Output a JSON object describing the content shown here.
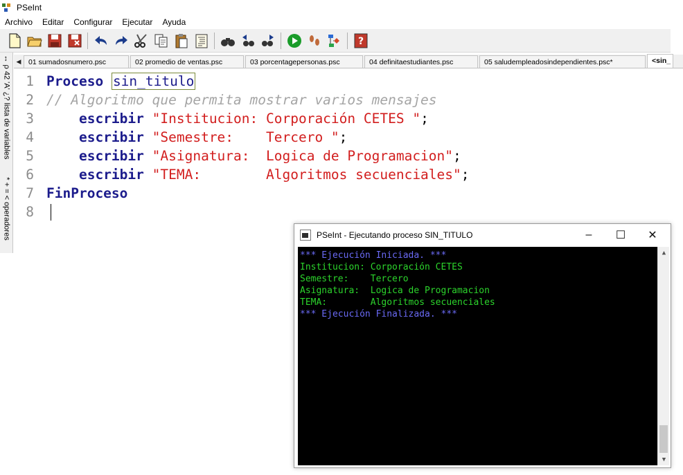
{
  "window": {
    "title": "PSeInt"
  },
  "menu": [
    "Archivo",
    "Editar",
    "Configurar",
    "Ejecutar",
    "Ayuda"
  ],
  "toolbar": {
    "icons": [
      "new-file-icon",
      "open-folder-icon",
      "save-icon",
      "save-as-icon",
      "undo-icon",
      "redo-icon",
      "cut-icon",
      "copy-icon",
      "paste-icon",
      "correct-indent-icon",
      "find-icon",
      "find-previous-icon",
      "find-next-icon",
      "run-icon",
      "step-by-step-icon",
      "flowchart-icon",
      "help-icon"
    ]
  },
  "side_panel": {
    "variables_label": "↔ ρ 42 'A' ¿? lista de variables",
    "operators_label": "* + = < operadores"
  },
  "tabs": [
    {
      "label": "01 sumadosnumero.psc",
      "active": false
    },
    {
      "label": "02 promedio de ventas.psc",
      "active": false
    },
    {
      "label": "03 porcentagepersonas.psc",
      "active": false
    },
    {
      "label": "04 definitaestudiantes.psc",
      "active": false
    },
    {
      "label": "05 saludempleadosindependientes.psc*",
      "active": false
    },
    {
      "label": "<sin_",
      "active": true
    }
  ],
  "editor": {
    "line_numbers": [
      "1",
      "2",
      "3",
      "4",
      "5",
      "6",
      "7",
      "8"
    ],
    "proceso_kw": "Proceso",
    "proceso_name": "sin_titulo",
    "comment": "// Algoritmo que permita mostrar varios mensajes",
    "escribir_kw": "escribir",
    "strings": [
      "\"Institucion: Corporación CETES \"",
      "\"Semestre:    Tercero \"",
      "\"Asignatura:  Logica de Programacion\"",
      "\"TEMA:        Algoritmos secuenciales\""
    ],
    "end_kw": "FinProceso"
  },
  "console": {
    "title": "PSeInt - Ejecutando proceso SIN_TITULO",
    "lines": [
      "*** Ejecución Iniciada. ***",
      "Institucion: Corporación CETES",
      "Semestre:    Tercero",
      "Asignatura:  Logica de Programacion",
      "TEMA:        Algoritmos secuenciales",
      "*** Ejecución Finalizada. ***"
    ],
    "colors": {
      "system": "#6a6af5",
      "output": "#2cd42c",
      "background": "#000000"
    }
  }
}
